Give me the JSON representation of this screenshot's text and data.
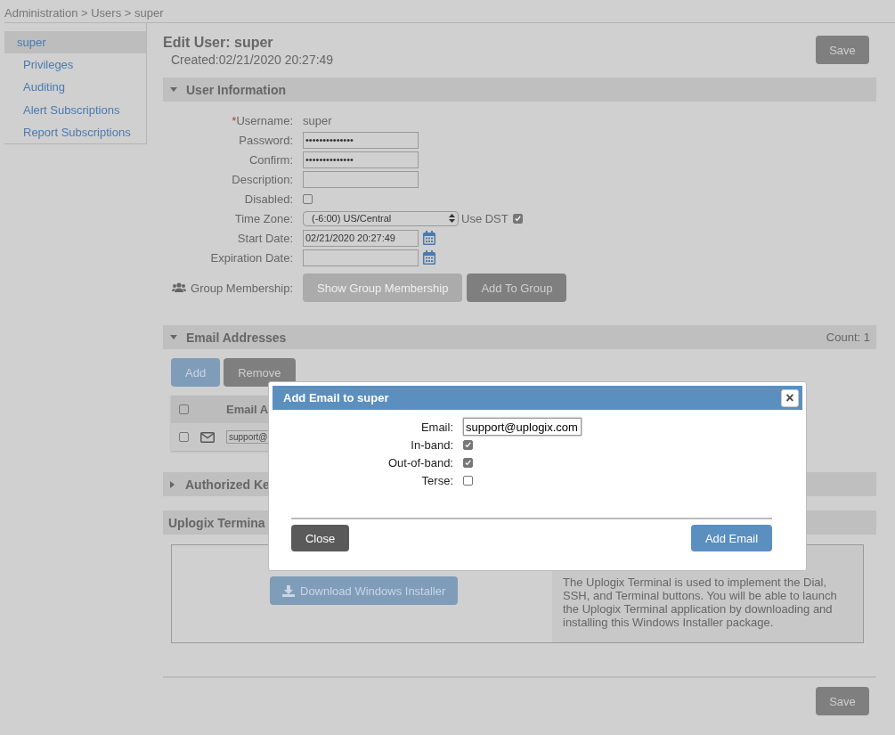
{
  "breadcrumb": "Administration > Users > super",
  "sidebar": {
    "items": [
      {
        "label": "super",
        "selected": true
      },
      {
        "label": "Privileges",
        "selected": false
      },
      {
        "label": "Auditing",
        "selected": false
      },
      {
        "label": "Alert Subscriptions",
        "selected": false
      },
      {
        "label": "Report Subscriptions",
        "selected": false
      }
    ]
  },
  "header": {
    "title": "Edit User: super",
    "created": "Created:02/21/2020 20:27:49",
    "save": "Save"
  },
  "user_information": {
    "title": "User Information",
    "expanded": true,
    "fields": [
      {
        "kind": "text",
        "label": "Username:",
        "required_mark": "*",
        "value": "super"
      },
      {
        "kind": "input",
        "label": "Password:",
        "value": "••••••••••••••"
      },
      {
        "kind": "input",
        "label": "Confirm:",
        "value": "••••••••••••••"
      },
      {
        "kind": "input",
        "label": "Description:"
      },
      {
        "kind": "checkbox",
        "label": "Disabled:",
        "checked": false
      },
      {
        "kind": "select",
        "label": "Time Zone:",
        "value": "(-6:00) US/Central",
        "extra_label": "Use DST",
        "extra_checked": true
      },
      {
        "kind": "date",
        "label": "Start Date:",
        "value": "02/21/2020 20:27:49"
      },
      {
        "kind": "date",
        "label": "Expiration Date:"
      },
      {
        "kind": "buttons",
        "label": "Group Membership:",
        "buttons": [
          {
            "label": "Show Group Membership",
            "disabled": true
          },
          {
            "label": "Add To Group",
            "disabled": false
          }
        ]
      }
    ]
  },
  "email_addresses": {
    "title": "Email Addresses",
    "expanded": true,
    "count": "Count: 1",
    "buttons": [
      "Add",
      "Remove"
    ],
    "table": {
      "select_all_checked": false,
      "columns": [
        "Email A"
      ],
      "rows": [
        {
          "checked": false,
          "email": "support@"
        }
      ]
    }
  },
  "authorized_keys": {
    "title": "Authorized Ke",
    "expanded": false
  },
  "uplogix_terminal": {
    "title": "Uplogix Termina",
    "download": "Download Windows Installer",
    "description": "The Uplogix Terminal is used to implement the Dial, SSH, and Terminal buttons. You will be able to launch the Uplogix Terminal application by downloading and installing this Windows Installer package."
  },
  "footer": {
    "save": "Save"
  },
  "dialog": {
    "title": "Add Email to super",
    "close_icon": "×",
    "email_label": "Email:",
    "email_value": "support@uplogix.com",
    "options": [
      {
        "label": "In-band:",
        "checked": true
      },
      {
        "label": "Out-of-band:",
        "checked": true
      },
      {
        "label": "Terse:",
        "checked": false
      }
    ],
    "close": "Close",
    "submit": "Add Email"
  }
}
